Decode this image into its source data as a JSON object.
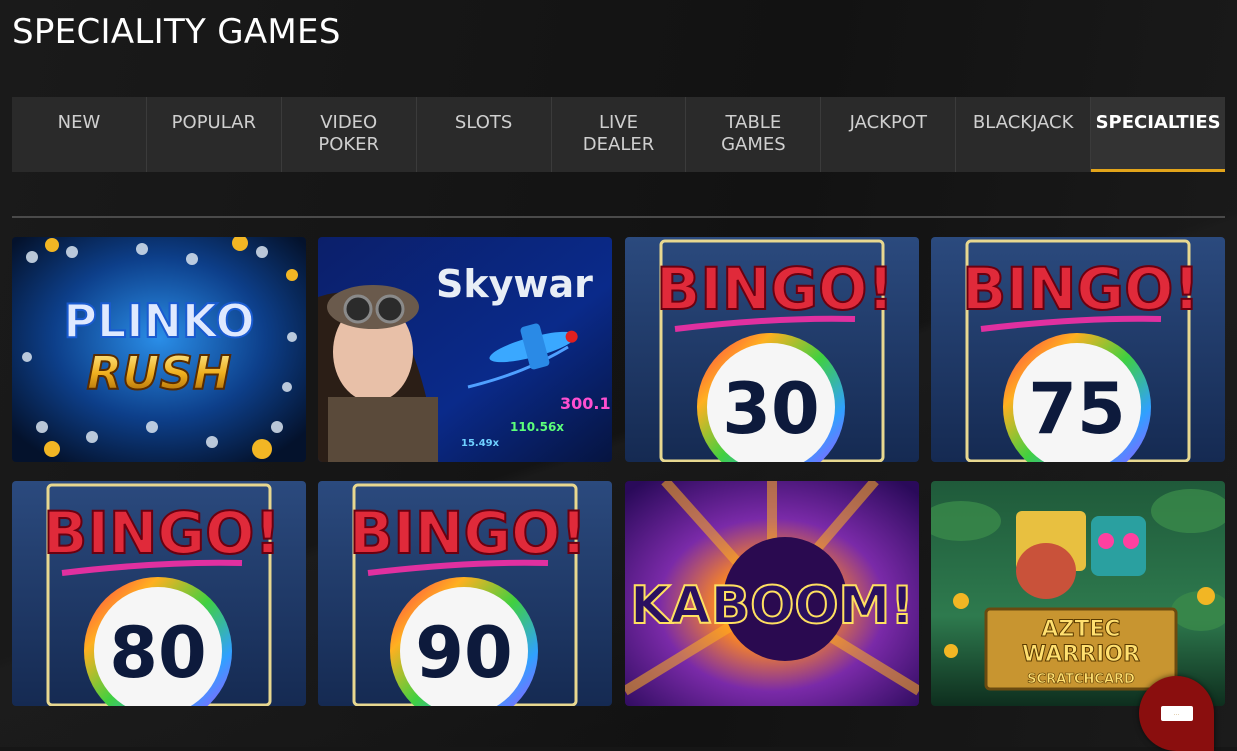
{
  "page": {
    "title": "SPECIALITY GAMES"
  },
  "tabs": [
    {
      "label": "NEW",
      "active": false
    },
    {
      "label": "POPULAR",
      "active": false
    },
    {
      "label": "VIDEO POKER",
      "active": false
    },
    {
      "label": "SLOTS",
      "active": false
    },
    {
      "label": "LIVE DEALER",
      "active": false
    },
    {
      "label": "TABLE GAMES",
      "active": false
    },
    {
      "label": "JACKPOT",
      "active": false
    },
    {
      "label": "BLACKJACK",
      "active": false
    },
    {
      "label": "SPECIALTIES",
      "active": true
    }
  ],
  "games": [
    {
      "name": "plinko-rush",
      "logo_line1": "PLINKO",
      "logo_line2": "RUSH"
    },
    {
      "name": "skyward",
      "logo": "Skywar",
      "multipliers": [
        "300.1",
        "110.56x",
        "15.49x"
      ]
    },
    {
      "name": "bingo-30",
      "logo": "BINGO!",
      "number": "30"
    },
    {
      "name": "bingo-75",
      "logo": "BINGO!",
      "number": "75"
    },
    {
      "name": "bingo-80",
      "logo": "BINGO!",
      "number": "80"
    },
    {
      "name": "bingo-90",
      "logo": "BINGO!",
      "number": "90"
    },
    {
      "name": "kaboom",
      "logo": "KABOOM!"
    },
    {
      "name": "aztec-warrior",
      "logo_line1": "AZTEC",
      "logo_line2": "WARRIOR",
      "logo_line3": "SCRATCHCARD"
    }
  ],
  "chat": {
    "icon": "chat-bubble-icon"
  },
  "colors": {
    "accent": "#e2a41a",
    "tab_bg": "#2a2a2a",
    "page_bg": "#161616",
    "chat_bg": "#8a0e0e"
  }
}
